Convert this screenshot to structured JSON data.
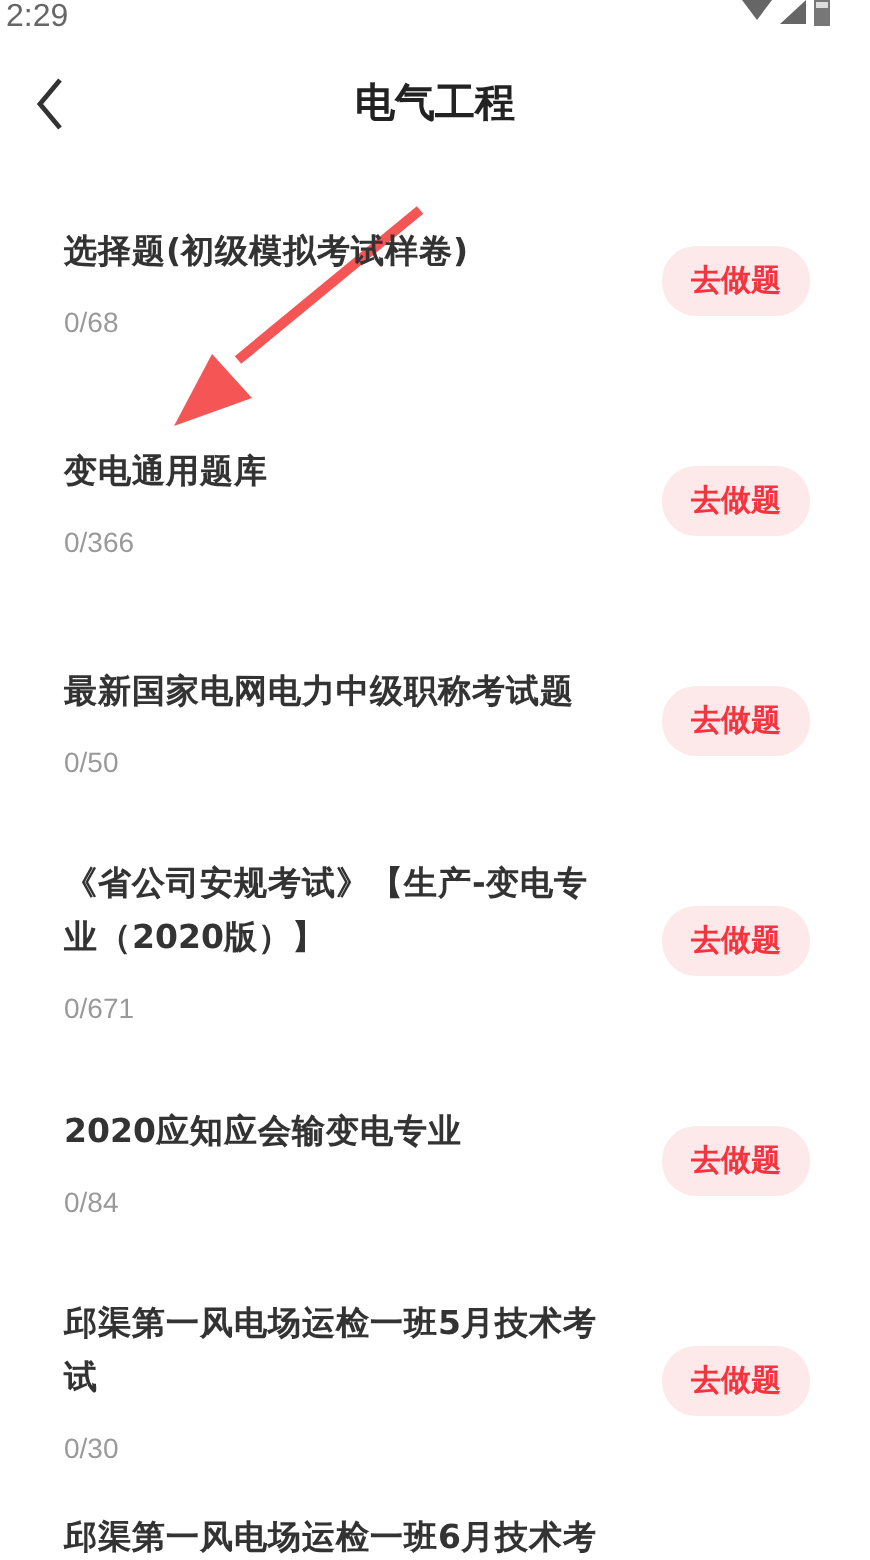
{
  "status_bar": {
    "time": "2:29"
  },
  "header": {
    "title": "电气工程"
  },
  "items": [
    {
      "title": "选择题(初级模拟考试样卷)",
      "progress": "0/68",
      "action": "去做题"
    },
    {
      "title": "变电通用题库",
      "progress": "0/366",
      "action": "去做题"
    },
    {
      "title": "最新国家电网电力中级职称考试题",
      "progress": "0/50",
      "action": "去做题"
    },
    {
      "title": "《省公司安规考试》【生产-变电专业（2020版）】",
      "progress": "0/671",
      "action": "去做题"
    },
    {
      "title": "2020应知应会输变电专业",
      "progress": "0/84",
      "action": "去做题"
    },
    {
      "title": "邱渠第一风电场运检一班5月技术考试",
      "progress": "0/30",
      "action": "去做题"
    },
    {
      "title": "邱渠第一风电场运检一班6月技术考"
    }
  ]
}
